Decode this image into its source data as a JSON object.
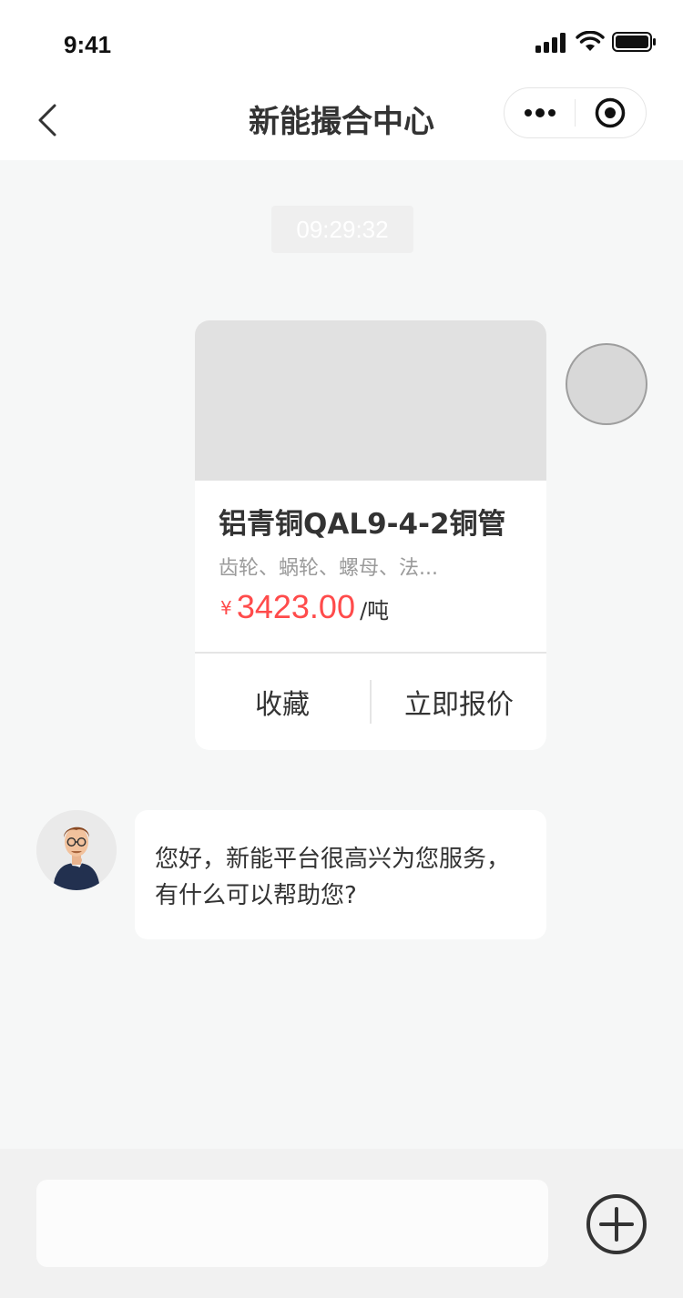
{
  "status_bar": {
    "time": "9:41"
  },
  "nav": {
    "title": "新能撮合中心",
    "back_icon": "chevron-left-icon",
    "more_icon": "more-dots-icon",
    "close_icon": "target-icon"
  },
  "chat": {
    "timestamp": "09:29:32",
    "product_card": {
      "name": "铝青铜QAL9-4-2铜管",
      "description": "齿轮、蜗轮、螺母、法...",
      "price_symbol": "¥",
      "price": "3423.00",
      "unit": "/吨",
      "actions": [
        "收藏",
        "立即报价"
      ]
    },
    "agent_message": {
      "line1": "您好，新能平台很高兴为您服务，",
      "line2": "有什么可以帮助您?"
    }
  },
  "input": {
    "placeholder": "",
    "add_icon": "plus-circle-icon"
  },
  "colors": {
    "accent_price": "#ff4b4b",
    "background": "#f6f7f7",
    "text": "#333333"
  }
}
